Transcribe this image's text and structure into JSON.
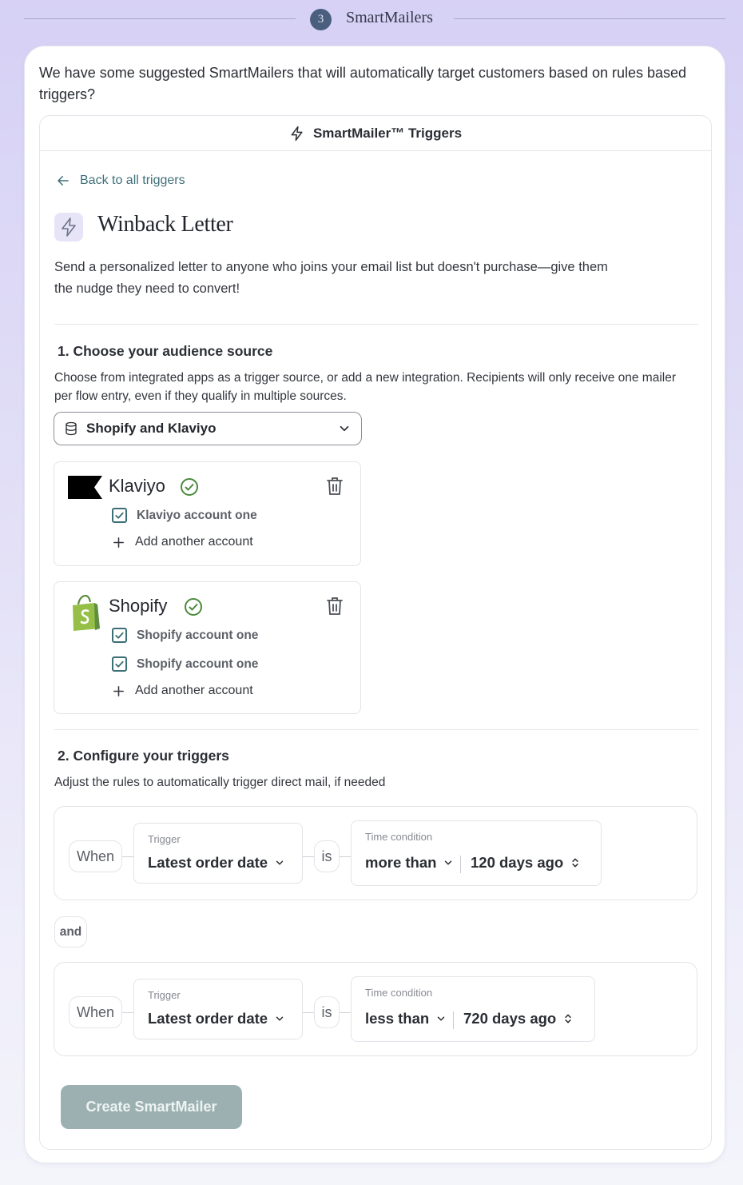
{
  "step": {
    "number": "3",
    "title": "SmartMailers"
  },
  "intro": "We have some suggested SmartMailers that will automatically target customers based on rules based triggers?",
  "panel": {
    "header": "SmartMailer™ Triggers",
    "back_label": "Back to all triggers",
    "title": "Winback Letter",
    "description": "Send a personalized letter to anyone who joins your email list but doesn't purchase—give them the nudge they need to convert!"
  },
  "audience": {
    "heading": "1. Choose your audience source",
    "description": "Choose from integrated apps as a trigger source, or add a new integration. Recipients will only receive one mailer per flow entry, even if they qualify in multiple sources.",
    "selected_source": "Shopify and Klaviyo",
    "sources": [
      {
        "name": "Klaviyo",
        "accounts": [
          "Klaviyo account one"
        ],
        "add_label": "Add another account"
      },
      {
        "name": "Shopify",
        "accounts": [
          "Shopify account one",
          "Shopify account one"
        ],
        "add_label": "Add another account"
      }
    ]
  },
  "triggers": {
    "heading": "2. Configure your triggers",
    "description": "Adjust the rules to automatically trigger direct mail, if needed",
    "joiner": "and",
    "rules": [
      {
        "when": "When",
        "trigger_label": "Trigger",
        "trigger_value": "Latest order date",
        "is": "is",
        "condition_label": "Time condition",
        "operator": "more than",
        "amount": "120 days ago"
      },
      {
        "when": "When",
        "trigger_label": "Trigger",
        "trigger_value": "Latest order date",
        "is": "is",
        "condition_label": "Time condition",
        "operator": "less than",
        "amount": "720 days ago"
      }
    ]
  },
  "create_button": "Create SmartMailer",
  "colors": {
    "accent": "#3f6f78",
    "button_disabled": "#9cb0b1",
    "success": "#4a8a3a",
    "step_badge": "#4a5e7e"
  }
}
